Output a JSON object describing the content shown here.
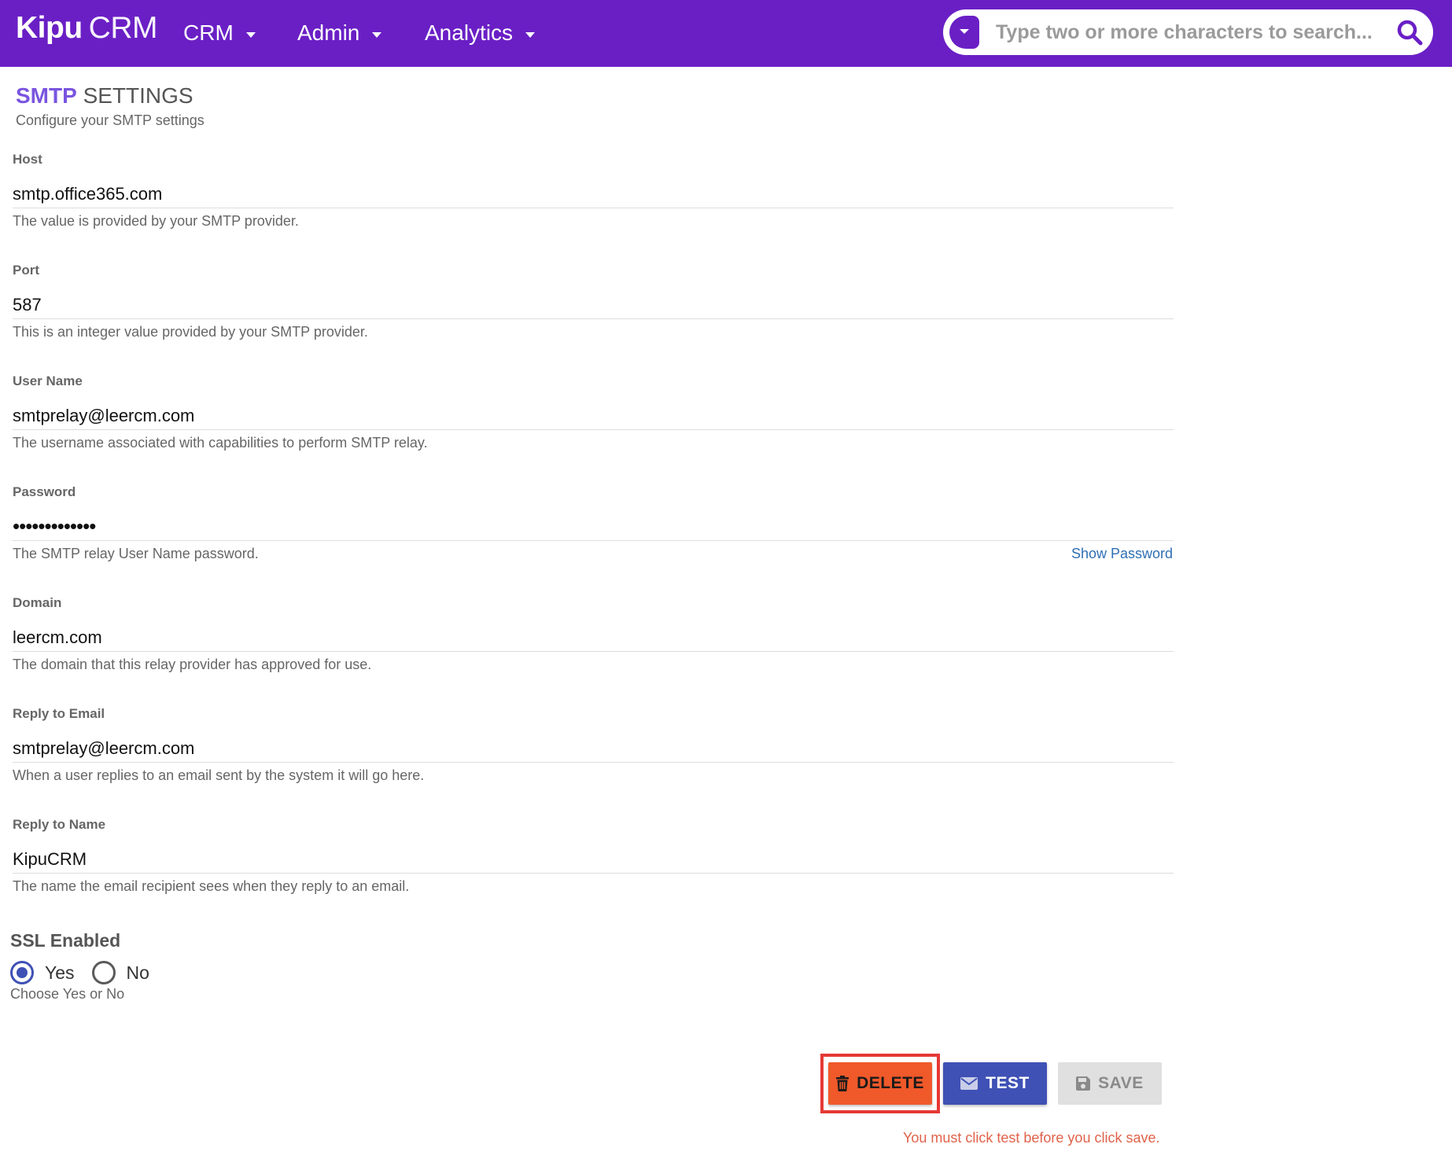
{
  "nav": {
    "brand_bold": "Kipu",
    "brand_light": "CRM",
    "menus": [
      {
        "label": "CRM"
      },
      {
        "label": "Admin"
      },
      {
        "label": "Analytics"
      }
    ],
    "search": {
      "placeholder": "Type two or more characters to search...",
      "icon": "search-icon"
    }
  },
  "header": {
    "title_accent": "SMTP",
    "title_rest": "SETTINGS",
    "subtitle": "Configure your SMTP settings"
  },
  "form": {
    "fields": [
      {
        "label": "Host",
        "value": "smtp.office365.com",
        "help": "The value is provided by your SMTP provider."
      },
      {
        "label": "Port",
        "value": "587",
        "help": "This is an integer value provided by your SMTP provider."
      },
      {
        "label": "User Name",
        "value": "smtprelay@leercm.com",
        "help": "The username associated with capabilities to perform SMTP relay."
      },
      {
        "label": "Password",
        "value": "•••••••••••••",
        "help": "The SMTP relay User Name password.",
        "link": "Show Password"
      },
      {
        "label": "Domain",
        "value": "leercm.com",
        "help": "The domain that this relay provider has approved for use."
      },
      {
        "label": "Reply to Email",
        "value": "smtprelay@leercm.com",
        "help": "When a user replies to an email sent by the system it will go here."
      },
      {
        "label": "Reply to Name",
        "value": "KipuCRM",
        "help": "The name the email recipient sees when they reply to an email."
      }
    ],
    "ssl": {
      "label": "SSL Enabled",
      "options": [
        {
          "label": "Yes",
          "checked": true
        },
        {
          "label": "No",
          "checked": false
        }
      ],
      "help": "Choose Yes or No"
    }
  },
  "actions": {
    "delete_label": "DELETE",
    "test_label": "TEST",
    "save_label": "SAVE",
    "note": "You must click test before you click save."
  },
  "colors": {
    "nav_bg": "#6a1fc5",
    "accent": "#7a55e0",
    "delete": "#f0592a",
    "test": "#3f51b5",
    "save_disabled": "#e0e0e0",
    "link": "#2f6fb4",
    "warning_text": "#e0624a"
  }
}
